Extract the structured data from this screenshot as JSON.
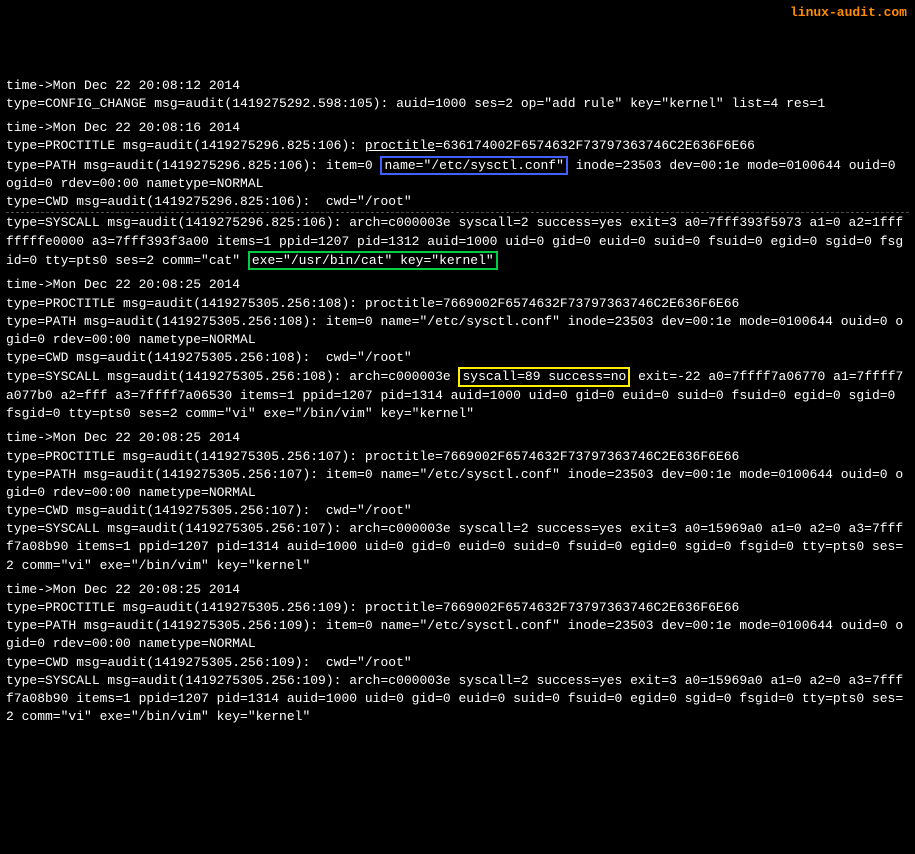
{
  "watermark": "linux-audit.com",
  "highlights": {
    "blue": "name=\"/etc/sysctl.conf\"",
    "green": "exe=\"/usr/bin/cat\" key=\"kernel\"",
    "yellow": "syscall=89 success=no"
  },
  "blocks": [
    {
      "lines": [
        "time->Mon Dec 22 20:08:12 2014",
        "type=CONFIG_CHANGE msg=audit(1419275292.598:105): auid=1000 ses=2 op=\"add rule\" key=\"kernel\" list=4 res=1"
      ]
    },
    {
      "lines": [
        "time->Mon Dec 22 20:08:16 2014",
        {
          "parts": [
            {
              "text": "type=PROCTITLE msg=audit(1419275296.825:106): "
            },
            {
              "text": "proctitle",
              "class": "underline"
            },
            {
              "text": "=636174002F6574632F73797363746C2E636F6E66"
            }
          ]
        },
        {
          "parts": [
            {
              "text": "type=PATH msg=audit(1419275296.825:106): item=0 "
            },
            {
              "text": "name=\"/etc/sysctl.conf\"",
              "class": "hl-blue"
            },
            {
              "text": " inode=23503 dev=00:1e mode=0100644 ouid=0 ogid=0 rdev=00:00 nametype=NORMAL"
            }
          ]
        },
        "type=CWD msg=audit(1419275296.825:106):  cwd=\"/root\"",
        {
          "parts": [
            {
              "text": "type=SYSCALL msg=audit(1419275296.825:106): arch=c000003e syscall=2 success=yes exit=3 a0=7fff393f5973 a1=0 a2=1ffffffffe0000 a3=7fff393f3a00 items=1 ppid=1207 pid=1312 auid=1000 uid=0 gid=0 euid=0 suid=0 fsuid=0 egid=0 sgid=0 fsgid=0 tty=pts0 ses=2 comm=\"cat\" "
            },
            {
              "text": "exe=\"/usr/bin/cat\" key=\"kernel\"",
              "class": "hl-green"
            }
          ]
        }
      ],
      "dashedBefore": [
        4
      ]
    },
    {
      "lines": [
        "time->Mon Dec 22 20:08:25 2014",
        "type=PROCTITLE msg=audit(1419275305.256:108): proctitle=7669002F6574632F73797363746C2E636F6E66",
        "type=PATH msg=audit(1419275305.256:108): item=0 name=\"/etc/sysctl.conf\" inode=23503 dev=00:1e mode=0100644 ouid=0 ogid=0 rdev=00:00 nametype=NORMAL",
        "type=CWD msg=audit(1419275305.256:108):  cwd=\"/root\"",
        {
          "parts": [
            {
              "text": "type=SYSCALL msg=audit(1419275305.256:108): arch=c000003e "
            },
            {
              "text": "syscall=89 success=no",
              "class": "hl-yellow"
            },
            {
              "text": " exit=-22 a0=7ffff7a06770 a1=7ffff7a077b0 a2=fff a3=7ffff7a06530 items=1 ppid=1207 pid=1314 auid=1000 uid=0 gid=0 euid=0 suid=0 fsuid=0 egid=0 sgid=0 fsgid=0 tty=pts0 ses=2 comm=\"vi\" exe=\"/bin/vim\" key=\"kernel\""
            }
          ]
        }
      ]
    },
    {
      "lines": [
        "time->Mon Dec 22 20:08:25 2014",
        "type=PROCTITLE msg=audit(1419275305.256:107): proctitle=7669002F6574632F73797363746C2E636F6E66",
        "type=PATH msg=audit(1419275305.256:107): item=0 name=\"/etc/sysctl.conf\" inode=23503 dev=00:1e mode=0100644 ouid=0 ogid=0 rdev=00:00 nametype=NORMAL",
        "type=CWD msg=audit(1419275305.256:107):  cwd=\"/root\"",
        "type=SYSCALL msg=audit(1419275305.256:107): arch=c000003e syscall=2 success=yes exit=3 a0=15969a0 a1=0 a2=0 a3=7ffff7a08b90 items=1 ppid=1207 pid=1314 auid=1000 uid=0 gid=0 euid=0 suid=0 fsuid=0 egid=0 sgid=0 fsgid=0 tty=pts0 ses=2 comm=\"vi\" exe=\"/bin/vim\" key=\"kernel\""
      ]
    },
    {
      "lines": [
        "time->Mon Dec 22 20:08:25 2014",
        "type=PROCTITLE msg=audit(1419275305.256:109): proctitle=7669002F6574632F73797363746C2E636F6E66",
        "type=PATH msg=audit(1419275305.256:109): item=0 name=\"/etc/sysctl.conf\" inode=23503 dev=00:1e mode=0100644 ouid=0 ogid=0 rdev=00:00 nametype=NORMAL",
        "type=CWD msg=audit(1419275305.256:109):  cwd=\"/root\"",
        "type=SYSCALL msg=audit(1419275305.256:109): arch=c000003e syscall=2 success=yes exit=3 a0=15969a0 a1=0 a2=0 a3=7ffff7a08b90 items=1 ppid=1207 pid=1314 auid=1000 uid=0 gid=0 euid=0 suid=0 fsuid=0 egid=0 sgid=0 fsgid=0 tty=pts0 ses=2 comm=\"vi\" exe=\"/bin/vim\" key=\"kernel\""
      ]
    }
  ]
}
